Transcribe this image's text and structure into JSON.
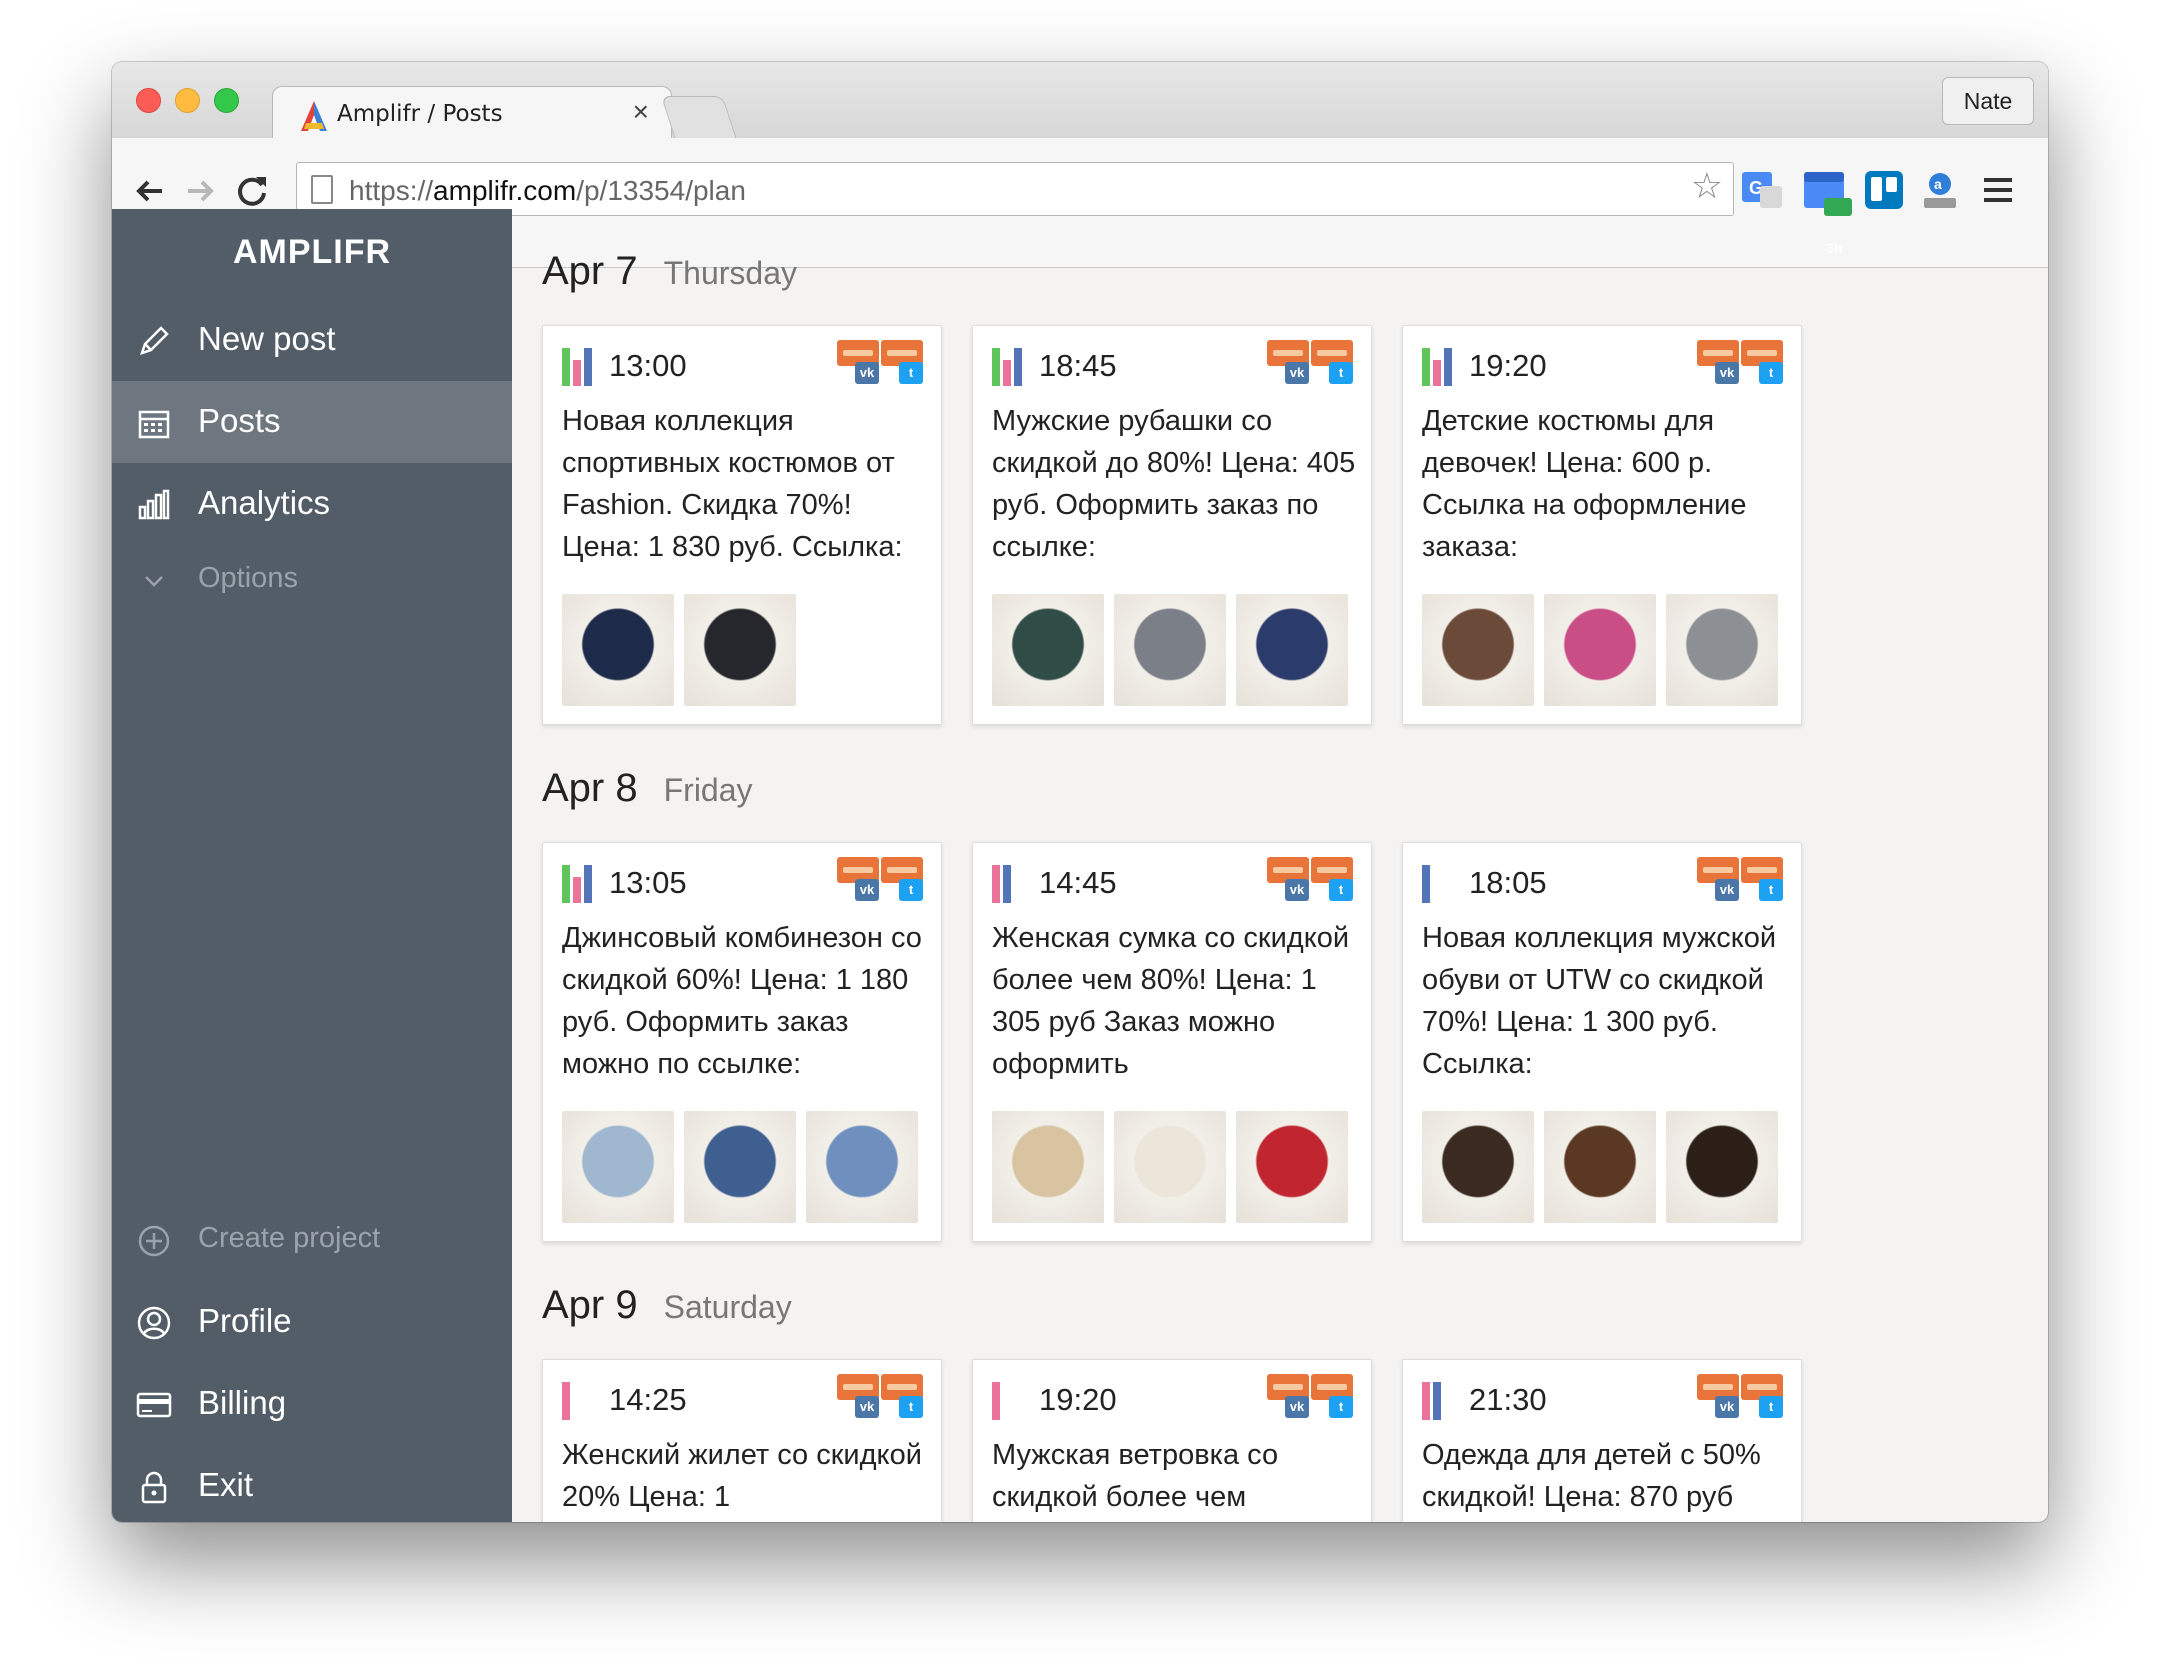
{
  "browser": {
    "tab_title": "Amplifr / Posts",
    "close_glyph": "×",
    "profile_name": "Nate",
    "url_scheme": "https://",
    "url_host": "amplifr.com",
    "url_path": "/p/13354/plan",
    "extension_badge": "3h"
  },
  "sidebar": {
    "logo": "AMPLIFR",
    "items": [
      {
        "label": "New post",
        "icon": "pencil-icon"
      },
      {
        "label": "Posts",
        "icon": "calendar-icon",
        "active": true
      },
      {
        "label": "Analytics",
        "icon": "bar-chart-icon"
      },
      {
        "label": "Options",
        "icon": "chevron-down-icon"
      }
    ],
    "bottom_items": [
      {
        "label": "Create project",
        "icon": "plus-circle-icon"
      },
      {
        "label": "Profile",
        "icon": "user-circle-icon"
      },
      {
        "label": "Billing",
        "icon": "credit-card-icon"
      },
      {
        "label": "Exit",
        "icon": "lock-icon"
      }
    ]
  },
  "days": [
    {
      "date": "Apr 7",
      "weekday": "Thursday",
      "posts": [
        {
          "time": "13:00",
          "text": "Новая коллекция спортивных костюмов от Fashion. Скидка 70%! Цена: 1 830 руб. Ссылка:",
          "bars": [
            "green",
            "pink",
            "blue"
          ],
          "thumbs": 2
        },
        {
          "time": "18:45",
          "text": "Мужские рубашки со скидкой до 80%! Цена: 405 руб. Оформить заказ по ссылке:",
          "bars": [
            "green",
            "pink",
            "blue"
          ],
          "thumbs": 3
        },
        {
          "time": "19:20",
          "text": "Детские костюмы для девочек! Цена: 600 р. Ссылка на оформление заказа:",
          "bars": [
            "green",
            "pink",
            "blue"
          ],
          "thumbs": 3
        }
      ]
    },
    {
      "date": "Apr 8",
      "weekday": "Friday",
      "posts": [
        {
          "time": "13:05",
          "text": "Джинсовый комбинезон со скидкой 60%! Цена: 1 180 руб. Оформить заказ можно по ссылке:",
          "bars": [
            "green",
            "pink",
            "blue"
          ],
          "thumbs": 3
        },
        {
          "time": "14:45",
          "text": "Женская сумка со скидкой более чем 80%! Цена: 1 305 руб Заказ можно оформить",
          "bars": [
            "pink",
            "blue"
          ],
          "thumbs": 3
        },
        {
          "time": "18:05",
          "text": "Новая коллекция мужской обуви от UTW со скидкой 70%! Цена: 1 300 руб. Ссылка:",
          "bars": [
            "blue"
          ],
          "thumbs": 3
        }
      ]
    },
    {
      "date": "Apr 9",
      "weekday": "Saturday",
      "posts": [
        {
          "time": "14:25",
          "text": "Женский жилет со скидкой 20% Цена: 1",
          "bars": [
            "pink"
          ],
          "thumbs": 0
        },
        {
          "time": "19:20",
          "text": "Мужская ветровка со скидкой более чем",
          "bars": [
            "pink"
          ],
          "thumbs": 0
        },
        {
          "time": "21:30",
          "text": "Одежда для детей с 50% скидкой! Цена: 870 руб",
          "bars": [
            "pink",
            "blue"
          ],
          "thumbs": 0
        }
      ]
    }
  ],
  "help_glyph": "?",
  "network_badges": {
    "vk": "vk",
    "tw": "t"
  },
  "colors": {
    "sidebar_bg": "#535d67",
    "active_item": "#6e7780",
    "bar_green": "#5fc45b",
    "bar_pink": "#e9739a",
    "bar_blue": "#5474b8",
    "help_button": "#36c2a2"
  }
}
